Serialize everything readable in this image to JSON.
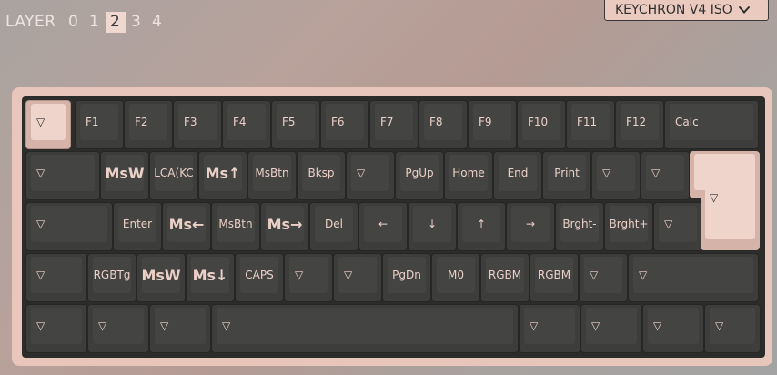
{
  "layers": {
    "label": "LAYER",
    "items": [
      "0",
      "1",
      "2",
      "3",
      "4"
    ],
    "active": "2"
  },
  "keyboard_select": {
    "value": "KEYCHRON V4 ISO"
  },
  "keys": {
    "r1": [
      "▽",
      "F1",
      "F2",
      "F3",
      "F4",
      "F5",
      "F6",
      "F7",
      "F8",
      "F9",
      "F10",
      "F11",
      "F12",
      "Calc"
    ],
    "r2": [
      "▽",
      "MsW",
      "LCA(KC",
      "Ms↑",
      "MsBtn",
      "Bksp",
      "▽",
      "PgUp",
      "Home",
      "End",
      "Print",
      "▽",
      "▽"
    ],
    "r3": [
      "▽",
      "Enter",
      "Ms←",
      "MsBtn",
      "Ms→",
      "Del",
      "←",
      "↓",
      "↑",
      "→",
      "Brght-",
      "Brght+",
      "▽"
    ],
    "r4": [
      "▽",
      "RGBTg",
      "MsW",
      "Ms↓",
      "CAPS",
      "▽",
      "▽",
      "PgDn",
      "M0",
      "RGBM",
      "RGBM",
      "▽",
      "▽"
    ],
    "r5": [
      "▽",
      "▽",
      "▽",
      "▽",
      "▽",
      "▽",
      "▽",
      "▽"
    ],
    "iso_enter": "▽"
  }
}
